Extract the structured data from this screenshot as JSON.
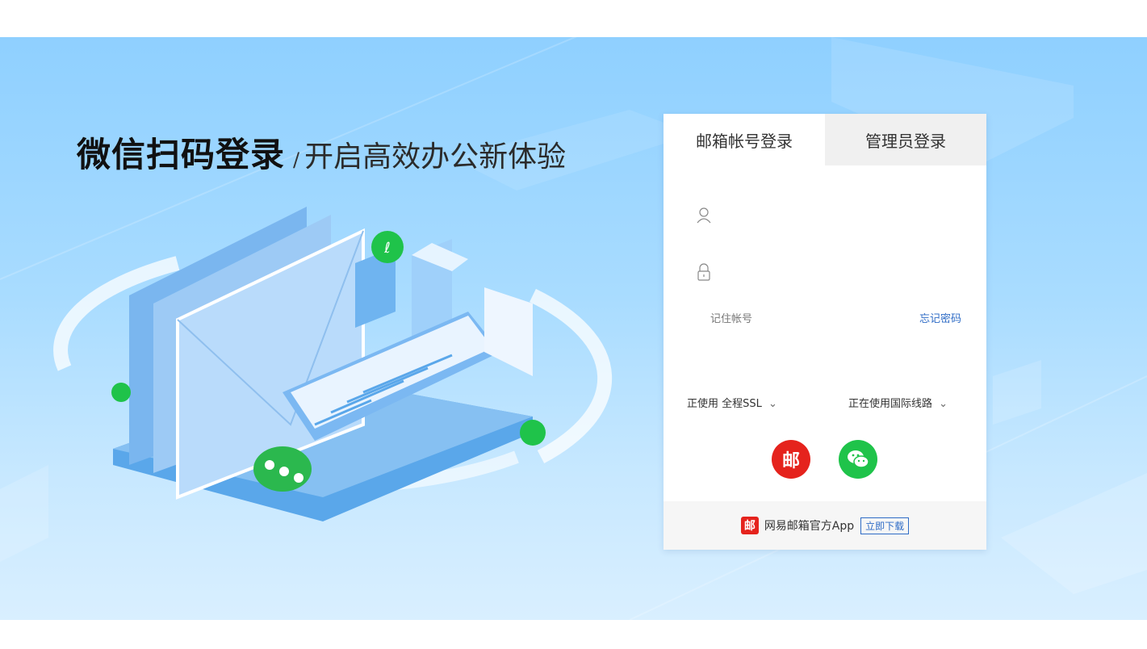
{
  "headline": {
    "main": "微信扫码登录",
    "separator": "/",
    "sub": "开启高效办公新体验"
  },
  "login": {
    "tabs": [
      {
        "label": "邮箱帐号登录",
        "active": true
      },
      {
        "label": "管理员登录",
        "active": false
      }
    ],
    "username": {
      "icon": "user-icon",
      "value": "",
      "placeholder": ""
    },
    "password": {
      "icon": "lock-icon",
      "value": "",
      "placeholder": ""
    },
    "remember_label": "记住帐号",
    "forgot_label": "忘记密码",
    "ssl_option": "正使用 全程SSL",
    "line_option": "正在使用国际线路",
    "quick_login": [
      {
        "icon": "netease-mail-icon",
        "glyph": "邮",
        "color": "#e5231d"
      },
      {
        "icon": "wechat-icon",
        "color": "#1fc34a"
      }
    ]
  },
  "footer": {
    "logo_glyph": "邮",
    "app_text": "网易邮箱官方App",
    "download_label": "立即下载"
  },
  "colors": {
    "accent": "#2f6cc6",
    "brand_red": "#e5231d",
    "wechat_green": "#1fc34a",
    "hero_blue": "#8fd0ff"
  }
}
